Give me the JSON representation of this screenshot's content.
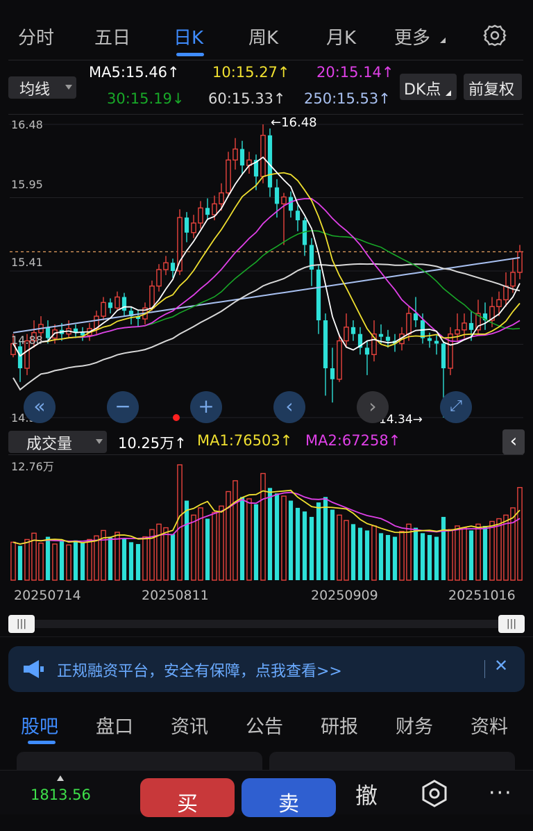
{
  "top_tabs": [
    "分时",
    "五日",
    "日K",
    "周K",
    "月K",
    "更多"
  ],
  "active_tab": "日K",
  "settings_icon": "gear-icon",
  "ma_dropdown": "均线",
  "ma": {
    "ma5": "MA5:15.46↑",
    "ma10": "10:15.27↑",
    "ma20": "20:15.14↑",
    "ma30": "30:15.19↓",
    "ma60": "60:15.33↑",
    "ma250": "250:15.53↑"
  },
  "dk_button": "DK点",
  "adjust_button": "前复权",
  "price_axis": [
    "16.48",
    "15.95",
    "15.41",
    "14.88",
    "14.34"
  ],
  "max_marker": "←16.48",
  "min_marker": "14.34→",
  "volume": {
    "dropdown": "成交量",
    "current": "10.25万↑",
    "ma1": "MA1:76503↑",
    "ma2": "MA2:67258↑",
    "axis_max": "12.76万"
  },
  "dates": [
    "20250714",
    "20250811",
    "20250909",
    "20251016"
  ],
  "banner_text": "正规融资平台，安全有保障，点我查看>>",
  "bottom_tabs": [
    "股吧",
    "盘口",
    "资讯",
    "公告",
    "研报",
    "财务",
    "资料"
  ],
  "active_bottom_tab": "股吧",
  "index_value": "1813.56",
  "buy_label": "买",
  "sell_label": "卖",
  "cancel_label": "撤",
  "colors": {
    "up": "#e8433d",
    "down": "#2ee0d8",
    "ma5": "#ffffff",
    "ma10": "#f0e030",
    "ma20": "#e040e8",
    "ma30": "#18a828",
    "ma60": "#d8d8d8",
    "ma250": "#a8c0f0",
    "accent": "#3f8cff"
  },
  "chart_data": {
    "type": "candlestick",
    "price_range": [
      14.34,
      16.48
    ],
    "last_close": 15.55,
    "max_high": 16.48,
    "min_low": 14.34,
    "candles": [
      [
        14.8,
        14.88,
        14.78,
        14.95
      ],
      [
        14.86,
        14.7,
        14.6,
        14.9
      ],
      [
        14.7,
        14.9,
        14.65,
        14.95
      ],
      [
        14.9,
        14.96,
        14.85,
        15.05
      ],
      [
        14.96,
        15.02,
        14.9,
        15.08
      ],
      [
        15.0,
        14.92,
        14.88,
        15.05
      ],
      [
        14.92,
        14.98,
        14.88,
        15.02
      ],
      [
        14.98,
        14.95,
        14.9,
        15.03
      ],
      [
        14.95,
        14.99,
        14.92,
        15.05
      ],
      [
        14.99,
        14.96,
        14.92,
        15.02
      ],
      [
        14.96,
        14.94,
        14.9,
        15.0
      ],
      [
        14.94,
        14.99,
        14.9,
        15.03
      ],
      [
        14.99,
        15.08,
        14.95,
        15.12
      ],
      [
        15.08,
        15.18,
        15.05,
        15.22
      ],
      [
        15.18,
        15.14,
        15.1,
        15.21
      ],
      [
        15.14,
        15.22,
        15.12,
        15.26
      ],
      [
        15.22,
        15.12,
        15.08,
        15.25
      ],
      [
        15.12,
        15.08,
        15.02,
        15.15
      ],
      [
        15.08,
        15.06,
        15.0,
        15.12
      ],
      [
        15.06,
        15.14,
        15.02,
        15.18
      ],
      [
        15.14,
        15.3,
        15.12,
        15.34
      ],
      [
        15.3,
        15.42,
        15.26,
        15.46
      ],
      [
        15.42,
        15.47,
        15.38,
        15.52
      ],
      [
        15.47,
        15.41,
        15.36,
        15.5
      ],
      [
        15.41,
        15.8,
        15.38,
        15.86
      ],
      [
        15.8,
        15.69,
        15.62,
        15.84
      ],
      [
        15.69,
        15.76,
        15.65,
        15.82
      ],
      [
        15.76,
        15.87,
        15.72,
        15.92
      ],
      [
        15.87,
        15.82,
        15.78,
        15.94
      ],
      [
        15.82,
        15.9,
        15.78,
        15.96
      ],
      [
        15.9,
        15.98,
        15.85,
        16.05
      ],
      [
        15.98,
        16.22,
        15.95,
        16.28
      ],
      [
        16.22,
        16.3,
        16.15,
        16.38
      ],
      [
        16.3,
        16.18,
        16.12,
        16.36
      ],
      [
        16.18,
        16.22,
        16.12,
        16.28
      ],
      [
        16.22,
        16.1,
        16.0,
        16.26
      ],
      [
        16.1,
        16.4,
        16.05,
        16.48
      ],
      [
        16.4,
        16.02,
        15.95,
        16.45
      ],
      [
        16.02,
        15.9,
        15.8,
        16.08
      ],
      [
        15.9,
        15.95,
        15.6,
        15.98
      ],
      [
        15.95,
        15.85,
        15.8,
        15.99
      ],
      [
        15.85,
        15.78,
        15.7,
        15.89
      ],
      [
        15.78,
        15.6,
        15.52,
        15.8
      ],
      [
        15.6,
        15.42,
        15.3,
        15.65
      ],
      [
        15.42,
        15.05,
        14.95,
        15.45
      ],
      [
        15.05,
        14.7,
        14.5,
        15.1
      ],
      [
        14.7,
        14.62,
        14.45,
        14.85
      ],
      [
        14.62,
        14.9,
        14.6,
        14.95
      ],
      [
        14.9,
        15.0,
        14.85,
        15.1
      ],
      [
        15.0,
        14.95,
        14.9,
        15.05
      ],
      [
        14.95,
        14.85,
        14.8,
        15.0
      ],
      [
        14.85,
        14.8,
        14.65,
        14.9
      ],
      [
        14.8,
        14.95,
        14.75,
        15.05
      ],
      [
        14.95,
        14.93,
        14.88,
        15.02
      ],
      [
        14.93,
        14.9,
        14.85,
        14.98
      ],
      [
        14.9,
        14.88,
        14.82,
        14.95
      ],
      [
        14.88,
        14.95,
        14.83,
        15.0
      ],
      [
        14.95,
        15.1,
        14.9,
        15.15
      ],
      [
        15.1,
        15.05,
        15.0,
        15.22
      ],
      [
        15.05,
        14.92,
        14.88,
        15.1
      ],
      [
        14.92,
        14.9,
        14.85,
        14.96
      ],
      [
        14.9,
        14.88,
        14.8,
        14.94
      ],
      [
        14.88,
        14.7,
        14.34,
        14.9
      ],
      [
        14.7,
        14.95,
        14.65,
        15.0
      ],
      [
        14.95,
        14.98,
        14.9,
        15.1
      ],
      [
        14.98,
        15.03,
        14.92,
        15.1
      ],
      [
        15.03,
        14.98,
        14.9,
        15.12
      ],
      [
        14.98,
        15.1,
        14.95,
        15.2
      ],
      [
        15.1,
        15.05,
        14.98,
        15.18
      ],
      [
        15.05,
        15.15,
        15.0,
        15.22
      ],
      [
        15.15,
        15.2,
        15.08,
        15.26
      ],
      [
        15.2,
        15.3,
        15.15,
        15.4
      ],
      [
        15.3,
        15.4,
        15.25,
        15.5
      ],
      [
        15.4,
        15.55,
        15.35,
        15.6
      ]
    ],
    "volumes": [
      42000,
      38000,
      45000,
      52000,
      41000,
      48000,
      40000,
      43000,
      39000,
      44000,
      41000,
      45000,
      49000,
      55000,
      47000,
      53000,
      46000,
      42000,
      40000,
      48000,
      56000,
      62000,
      58000,
      51000,
      127600,
      88000,
      72000,
      80000,
      68000,
      75000,
      82000,
      98000,
      110000,
      92000,
      90000,
      84000,
      118000,
      102000,
      96000,
      93000,
      88000,
      80000,
      76000,
      70000,
      86000,
      92000,
      78000,
      72000,
      66000,
      62000,
      58000,
      55000,
      60000,
      52000,
      50000,
      48000,
      54000,
      62000,
      58000,
      52000,
      50000,
      48000,
      70000,
      56000,
      60000,
      58000,
      55000,
      62000,
      60000,
      65000,
      68000,
      72000,
      80000,
      102500
    ]
  }
}
